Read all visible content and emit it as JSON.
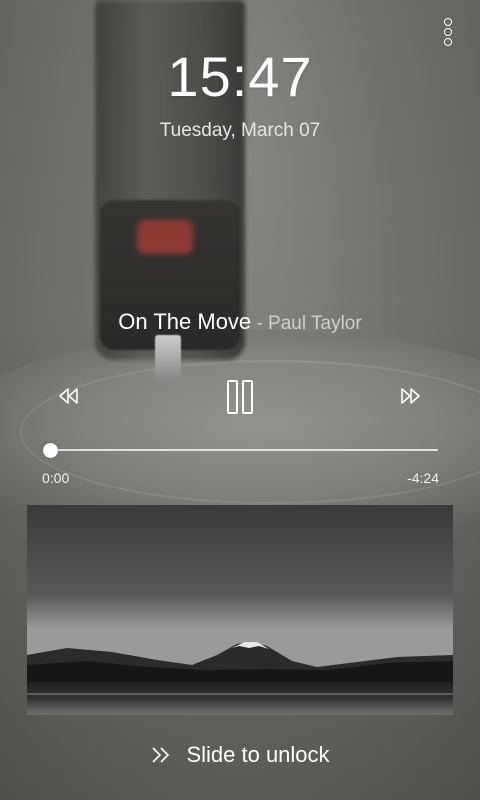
{
  "lockscreen": {
    "time": "15:47",
    "date": "Tuesday, March 07"
  },
  "player": {
    "title": "On The Move",
    "artist": " - Paul Taylor",
    "elapsed": "0:00",
    "remaining": "-4:24",
    "progress": 0.0,
    "state": "playing"
  },
  "unlock": {
    "label": "Slide to unlock"
  },
  "icons": {
    "overflow": "more-vertical-icon",
    "rewind": "rewind-icon",
    "pause": "pause-icon",
    "forward": "fast-forward-icon",
    "unlock": "double-chevron-right-icon"
  }
}
